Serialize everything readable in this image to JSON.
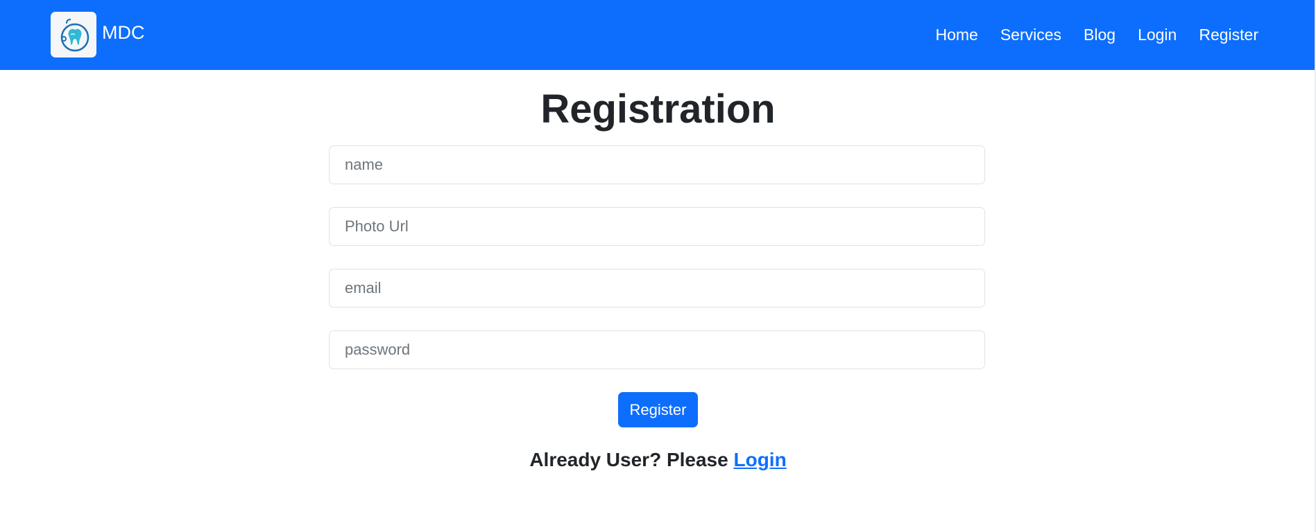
{
  "navbar": {
    "brand": {
      "name": "MDC",
      "logo_icon": "tooth-stethoscope-logo-icon"
    },
    "links": [
      "Home",
      "Services",
      "Blog",
      "Login",
      "Register"
    ],
    "background": "#0d6efd"
  },
  "main": {
    "title": "Registration",
    "fields": {
      "name_placeholder": "name",
      "photo_placeholder": "Photo Url",
      "email_placeholder": "email",
      "password_placeholder": "password"
    },
    "submit_label": "Register",
    "login_prompt": "Already User? Please",
    "login_link": "Login"
  },
  "colors": {
    "accent": "#0d6efd",
    "text": "#212529",
    "placeholder": "#6c757d"
  }
}
